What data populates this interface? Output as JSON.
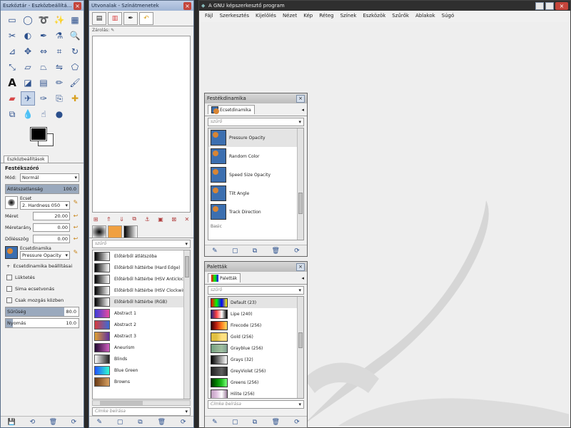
{
  "toolbox": {
    "title": "Eszköztár - Eszközbeállítá...",
    "tab_label": "Eszközbeállítások",
    "section_title": "Festékszóró",
    "mode_label": "Mód:",
    "mode_value": "Normál",
    "opacity_label": "Átlátszatlanság",
    "opacity_value": "100.0",
    "opacity_fraction": 1.0,
    "brush_label": "Ecset",
    "brush_value": "2. Hardness 050",
    "size_label": "Méret",
    "size_value": "20.00",
    "aspect_label": "Méretarány",
    "aspect_value": "0.00",
    "angle_label": "Dőlésszög",
    "angle_value": "0.00",
    "dynamics_label": "Ecsetdinamika",
    "dynamics_value": "Pressure Opacity",
    "dynamics_options": "Ecsetdinamika beállításai",
    "jitter_label": "Lüktetés",
    "smooth_label": "Sima ecsetvonás",
    "motion_label": "Csak mozgás közben",
    "rate_label": "Sűrűség",
    "rate_value": "80.0",
    "rate_fraction": 0.8,
    "pressure_label": "Nyomás",
    "pressure_value": "10.0",
    "pressure_fraction": 0.1
  },
  "layers": {
    "title": "Útvonalak - Színátmenetek",
    "history_label": "Zárolás:",
    "filter_placeholder": "szűrő",
    "tag_placeholder": "Címke beírása",
    "gradients": [
      {
        "name": "Előtérből átlátszóba",
        "colors": [
          "#000000",
          "#ffffff"
        ]
      },
      {
        "name": "Előtérből háttérbe (Hard Edge)",
        "colors": [
          "#000000",
          "#ffffff"
        ]
      },
      {
        "name": "Előtérből háttérbe (HSV Anticlockwise)",
        "colors": [
          "#000000",
          "#ffffff"
        ]
      },
      {
        "name": "Előtérből háttérbe (HSV Clockwise)",
        "colors": [
          "#000000",
          "#ffffff"
        ]
      },
      {
        "name": "Előtérből háttérbe (RGB)",
        "colors": [
          "#000000",
          "#ffffff"
        ]
      },
      {
        "name": "Abstract 1",
        "colors": [
          "#3b3bd8",
          "#e84aa0"
        ]
      },
      {
        "name": "Abstract 2",
        "colors": [
          "#d83b3b",
          "#3b6bd8"
        ]
      },
      {
        "name": "Abstract 3",
        "colors": [
          "#e0a030",
          "#6030a0"
        ]
      },
      {
        "name": "Aneurism",
        "colors": [
          "#200830",
          "#d060c0"
        ]
      },
      {
        "name": "Blinds",
        "colors": [
          "#ffffff",
          "#222222"
        ]
      },
      {
        "name": "Blue Green",
        "colors": [
          "#2050ff",
          "#30ffd0"
        ]
      },
      {
        "name": "Browns",
        "colors": [
          "#6a3a14",
          "#d8a060"
        ]
      }
    ]
  },
  "main": {
    "title": "A GNU képszerkesztő program",
    "menu": [
      "Fájl",
      "Szerkesztés",
      "Kijelölés",
      "Nézet",
      "Kép",
      "Réteg",
      "Színek",
      "Eszközök",
      "Szűrők",
      "Ablakok",
      "Súgó"
    ]
  },
  "dynamics_dock": {
    "title": "Festékdinamika",
    "tab_label": "Ecsetdinamika",
    "filter_placeholder": "szűrő",
    "items": [
      "Pressure Opacity",
      "Random Color",
      "Speed Size Opacity",
      "Tilt Angle",
      "Track Direction"
    ],
    "partial_label": "Basic"
  },
  "palettes_dock": {
    "title": "Paletták",
    "tab_label": "Paletták",
    "filter_placeholder": "szűrő",
    "tag_placeholder": "Címke beírása",
    "items": [
      {
        "name": "Default (23)",
        "colors": [
          "#ff0000",
          "#00ff00",
          "#0000ff",
          "#ffff00"
        ]
      },
      {
        "name": "Lipe (240)",
        "colors": [
          "#202080",
          "#ff4040",
          "#ffffff",
          "#000000"
        ]
      },
      {
        "name": "Firecode (256)",
        "colors": [
          "#300000",
          "#c02010",
          "#ff8020",
          "#ffe060"
        ]
      },
      {
        "name": "Gold (256)",
        "colors": [
          "#e0c040",
          "#e0c040",
          "#ffe080",
          "#ffe080"
        ]
      },
      {
        "name": "Grayblue (256)",
        "colors": [
          "#70a080",
          "#90b090",
          "#a0c0a0",
          "#80a090"
        ]
      },
      {
        "name": "Grays (32)",
        "colors": [
          "#000000",
          "#555555",
          "#aaaaaa",
          "#ffffff"
        ]
      },
      {
        "name": "GreyViolet (256)",
        "colors": [
          "#202020",
          "#404040",
          "#606060",
          "#303030"
        ]
      },
      {
        "name": "Greens (256)",
        "colors": [
          "#003000",
          "#008000",
          "#20c020",
          "#80ff80"
        ]
      },
      {
        "name": "Hilite (256)",
        "colors": [
          "#c0a0c0",
          "#e0c0e0",
          "#ffffff",
          "#a080a0"
        ]
      }
    ]
  }
}
